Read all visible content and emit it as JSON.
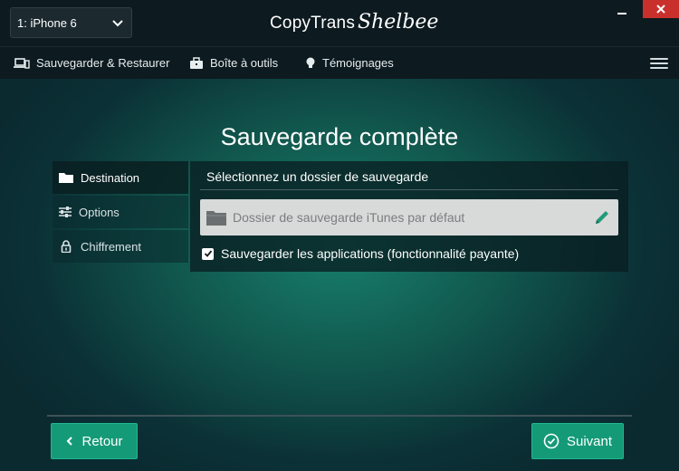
{
  "titlebar": {
    "device_selector": "1: iPhone 6",
    "brand_main": "CopyTrans",
    "brand_script": "Shelbee"
  },
  "menu": {
    "items": [
      {
        "label": "Sauvegarder & Restaurer",
        "icon": "laptop-phone-icon"
      },
      {
        "label": "Boîte à outils",
        "icon": "toolbox-icon"
      },
      {
        "label": "Témoignages",
        "icon": "lightbulb-icon"
      }
    ]
  },
  "main": {
    "title": "Sauvegarde complète",
    "tabs": [
      {
        "label": "Destination",
        "icon": "folder-icon",
        "active": true
      },
      {
        "label": "Options",
        "icon": "sliders-icon",
        "active": false
      },
      {
        "label": "Chiffrement",
        "icon": "lock-icon",
        "active": false
      }
    ],
    "panel": {
      "heading": "Sélectionnez un dossier de sauvegarde",
      "folder_field": "Dossier de sauvegarde iTunes par défaut",
      "checkbox_label": "Sauvegarder les applications (fonctionnalité payante)",
      "checkbox_checked": true
    }
  },
  "footer": {
    "back_label": "Retour",
    "next_label": "Suivant"
  },
  "colors": {
    "accent": "#159a78",
    "close": "#c9302c",
    "edit_pencil": "#1f9a78"
  }
}
